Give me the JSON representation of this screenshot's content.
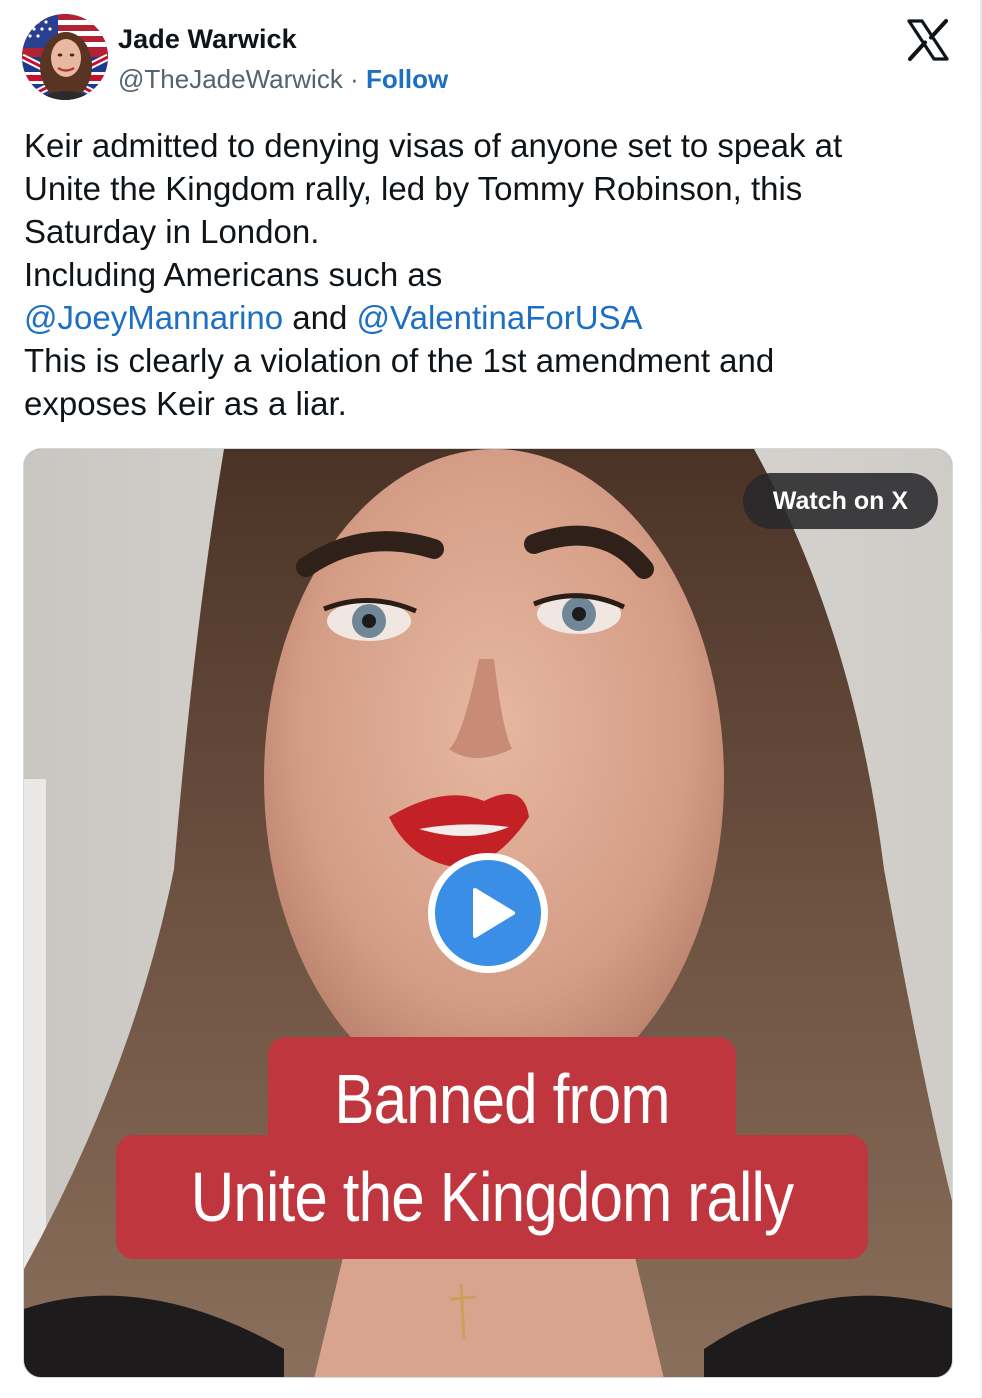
{
  "author": {
    "name": "Jade Warwick",
    "handle": "@TheJadeWarwick",
    "separator": " · ",
    "follow_label": "Follow"
  },
  "platform_icon": "x-logo-icon",
  "tweet": {
    "line1": "Keir admitted to denying visas of anyone set to speak at",
    "line2": "Unite the Kingdom rally, led by Tommy Robinson, this",
    "line3": "Saturday in London.",
    "line4": "Including Americans such as",
    "mention1": "@JoeyMannarino",
    "and_text": " and ",
    "mention2": "@ValentinaForUSA",
    "line6": "This is clearly a violation of the 1st amendment and",
    "line7": "exposes Keir as a liar."
  },
  "media": {
    "watch_label": "Watch on X",
    "caption_line1": "Banned from",
    "caption_line2": "Unite the Kingdom rally",
    "play_icon": "play-icon"
  },
  "colors": {
    "link": "#1d6fc4",
    "caption_bg": "#c0363f",
    "play_blue": "#3b8ee6"
  }
}
